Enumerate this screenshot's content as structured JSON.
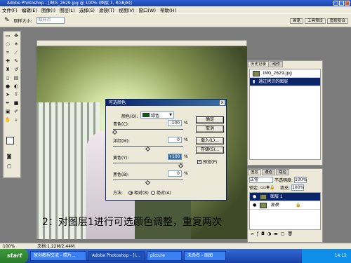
{
  "window": {
    "title": "Adobe Photoshop - [IMG_2629.jpg @ 100% (图层 1, RGB/8)]"
  },
  "menu": [
    "文件(F)",
    "编辑(E)",
    "图像(I)",
    "图层(L)",
    "选择(S)",
    "滤镜(T)",
    "视图(V)",
    "窗口(W)",
    "帮助(H)"
  ],
  "options": {
    "label": "取样大小:",
    "value": "取样点"
  },
  "palette_tabs": [
    "画笔",
    "工具预设",
    "图层复合"
  ],
  "caption": "2：对图层1进行可选颜色调整，重复两次",
  "dialog": {
    "title": "可选颜色",
    "color_label": "颜色(O):",
    "color_value": "绿色",
    "sliders": [
      {
        "label": "青色(C):",
        "value": "-100",
        "unit": "%",
        "level": 0.0
      },
      {
        "label": "洋红(M):",
        "value": "0",
        "unit": "%",
        "level": 0.5
      },
      {
        "label": "黄色(Y):",
        "value": "+100",
        "unit": "%",
        "level": 1.0
      },
      {
        "label": "黑色(B):",
        "value": "0",
        "unit": "%",
        "level": 0.5
      }
    ],
    "buttons": [
      "确定",
      "取消",
      "载入(L)...",
      "存储(S)..."
    ],
    "preview_label": "预览(P)",
    "method_label": "方法:",
    "method_relative": "相对(R)",
    "method_absolute": "绝对(A)"
  },
  "history": {
    "tabs": [
      "历史记录",
      "动作"
    ],
    "items": [
      "IMG_2629.jpg",
      "通过拷贝的图层"
    ]
  },
  "layers": {
    "tabs": [
      "图层",
      "通道",
      "路径"
    ],
    "blend_mode": "正常",
    "opacity_label": "不透明度:",
    "opacity": "100%",
    "lock_label": "锁定:",
    "fill_label": "填充:",
    "fill": "100%",
    "items": [
      "图层 1",
      "背景"
    ]
  },
  "status": {
    "zoom": "100%",
    "doc": "文档:1.22M/2.44M"
  },
  "taskbar": {
    "start": "start",
    "tasks": [
      "原创教程交流 - 照片...",
      "Adobe Photoshop - [I...",
      "picture",
      "未命名 - 画图"
    ],
    "time": "14:12"
  }
}
